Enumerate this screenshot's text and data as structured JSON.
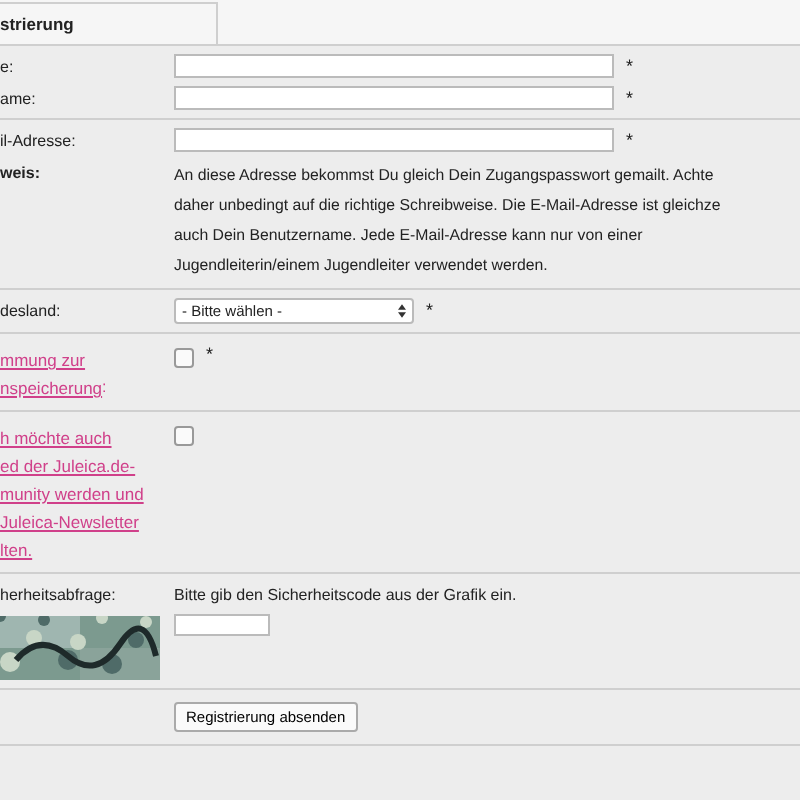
{
  "tab": {
    "label": "strierung"
  },
  "groups": [
    [
      {
        "kind": "text",
        "label": "e:",
        "required": "*"
      },
      {
        "kind": "text",
        "label": "ame:",
        "required": "*"
      }
    ],
    [
      {
        "kind": "text",
        "label": "il-Adresse:",
        "required": "*"
      },
      {
        "kind": "note",
        "label": "weis:",
        "lines": [
          "An diese Adresse bekommst Du gleich Dein Zugangspasswort gemailt. Achte",
          "daher unbedingt auf die richtige Schreibweise. Die E-Mail-Adresse ist gleichze",
          "auch Dein Benutzername. Jede E-Mail-Adresse kann nur von einer",
          "Jugendleiterin/einem Jugendleiter verwendet werden."
        ]
      }
    ],
    [
      {
        "kind": "select",
        "label": "desland:",
        "value": "- Bitte wählen -",
        "required": "*"
      }
    ],
    [
      {
        "kind": "checkbox",
        "label_lines": [
          "mmung zur",
          "nspeicherung"
        ],
        "label_tail": ":",
        "checked": false,
        "required": "*"
      }
    ],
    [
      {
        "kind": "checkbox",
        "label_lines": [
          "h möchte auch",
          "ed der Juleica.de-",
          "munity werden und",
          "Juleica-Newsletter",
          "lten."
        ],
        "checked": false
      }
    ],
    [
      {
        "kind": "captcha",
        "label": "herheitsabfrage:",
        "hint": "Bitte gib den Sicherheitscode aus der Grafik ein."
      }
    ],
    [
      {
        "kind": "submit",
        "button": "Registrierung absenden"
      }
    ]
  ]
}
